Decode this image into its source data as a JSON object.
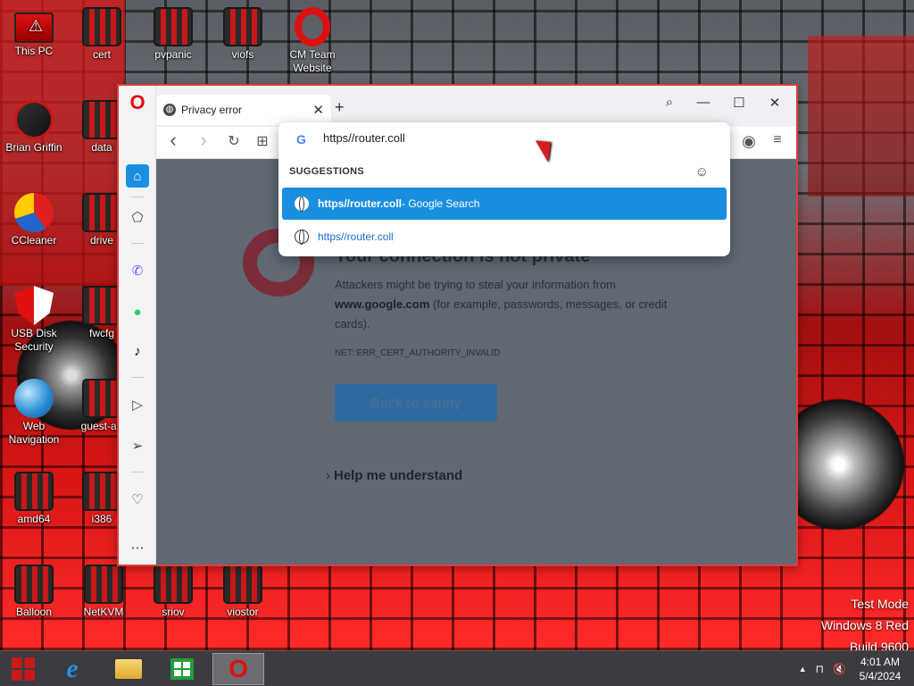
{
  "desktop": {
    "icons": [
      {
        "label": "This PC",
        "icon": "this-pc-icon"
      },
      {
        "label": "cert",
        "icon": "cert-folder-icon"
      },
      {
        "label": "pvpanic",
        "icon": "pvpanic-folder-icon"
      },
      {
        "label": "viofs",
        "icon": "viofs-folder-icon"
      },
      {
        "label": "CM Team Website",
        "icon": "opera-shortcut-icon"
      },
      {
        "label": "Brian Griffin",
        "icon": "user-folder-icon"
      },
      {
        "label": "data",
        "icon": "data-folder-icon"
      },
      {
        "label": "CCleaner",
        "icon": "ccleaner-icon"
      },
      {
        "label": "drive",
        "icon": "drive-folder-icon"
      },
      {
        "label": "USB Disk Security",
        "icon": "usb-security-icon"
      },
      {
        "label": "fwcfg",
        "icon": "fwcfg-folder-icon"
      },
      {
        "label": "Web Navigation",
        "icon": "web-navigation-icon"
      },
      {
        "label": "guest-ag",
        "icon": "guest-agent-folder-icon"
      },
      {
        "label": "amd64",
        "icon": "amd64-folder-icon"
      },
      {
        "label": "i386",
        "icon": "i386-folder-icon"
      },
      {
        "label": "Balloon",
        "icon": "balloon-folder-icon"
      },
      {
        "label": "NetKVM",
        "icon": "netkvm-folder-icon"
      },
      {
        "label": "sriov",
        "icon": "sriov-folder-icon"
      },
      {
        "label": "viostor",
        "icon": "viostor-folder-icon"
      }
    ],
    "watermark": [
      "Test Mode",
      "Windows 8 Red",
      "Build 9600"
    ]
  },
  "browser": {
    "tab_title": "Privacy error",
    "tab_close": "✕",
    "new_tab": "+",
    "window_controls": {
      "search": "⌕",
      "minimize": "—",
      "maximize": "☐",
      "close": "✕"
    },
    "toolbar": {
      "back": "‹",
      "forward": "›",
      "reload": "↻",
      "tiles": "⊞",
      "account": "◉",
      "settings": "≡"
    },
    "omnibox": {
      "provider_icon": "G",
      "input_value": "https//router.coll",
      "suggestions_label": "SUGGESTIONS",
      "suggestions": [
        {
          "bold": "https//router.coll",
          "suffix": " - Google Search"
        },
        {
          "text": "https//router.coll"
        }
      ]
    },
    "page": {
      "heading": "Your connection is not private",
      "body_pre": "Attackers might be trying to steal your information from ",
      "body_domain": "www.google.com",
      "body_post": " (for example, passwords, messages, or credit cards).",
      "error_code": "NET::ERR_CERT_AUTHORITY_INVALID",
      "back_button": "Back to safety",
      "help_link": "Help me understand"
    }
  },
  "taskbar": {
    "clock_time": "4:01 AM",
    "clock_date": "5/4/2024",
    "tray": {
      "arrow": "▲",
      "network": "⊓",
      "volume": "🔇"
    }
  },
  "colors": {
    "accent": "#1a8fe0",
    "opera_red": "#e01010",
    "page_bg": "#606873"
  }
}
